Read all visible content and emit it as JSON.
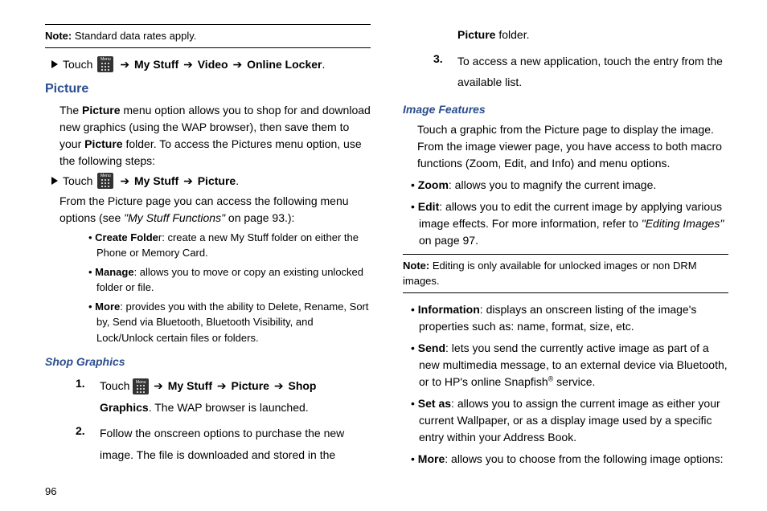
{
  "note1_label": "Note:",
  "note1_text": " Standard data rates apply.",
  "touch_label": "Touch ",
  "arrow": " ➔ ",
  "nav_mystuff": "My Stuff",
  "nav_video": "Video",
  "nav_online_locker": "Online Locker",
  "nav_picture": "Picture",
  "nav_shop_graphics": "Shop Graphics",
  "period": ".",
  "picture_heading": "Picture",
  "picture_p1a": "The ",
  "picture_p1b": "Picture",
  "picture_p1c": " menu option allows you to shop for and download new graphics (using the WAP browser), then save them to your ",
  "picture_p1d": "Picture",
  "picture_p1e": " folder. To access the Pictures menu option, use the following steps:",
  "picture_p2a": "From the Picture page you can access the following menu options (see ",
  "picture_p2b": "\"My Stuff Functions\"",
  "picture_p2c": " on page 93.):",
  "b1_label": "Create Folde",
  "b1_text": "r: create a new My Stuff folder on either the Phone or Memory Card.",
  "b2_label": "Manage",
  "b2_text": ": allows you to move or copy an existing unlocked folder or file.",
  "b3_label": "More",
  "b3_text": ": provides you with the ability to Delete, Rename, Sort by, Send via Bluetooth, Bluetooth Visibility, and Lock/Unlock certain files or folders.",
  "shop_heading": "Shop Graphics",
  "shop_step1_n": "1.",
  "shop_step1_c": ". The WAP browser is launched.",
  "shop_step2_n": "2.",
  "shop_step2a": "Follow the onscreen options to purchase the new image. The file is downloaded and stored in the ",
  "shop_step2b": "Picture",
  "shop_step2c": " folder.",
  "shop_step3_n": "3.",
  "shop_step3": "To access a new application, touch the entry from the available list.",
  "img_heading": "Image Features",
  "img_p1": "Touch a graphic from the Picture page to display the image. From the image viewer page, you have access to both macro functions (Zoom, Edit, and Info) and menu options.",
  "ib1_label": "Zoom",
  "ib1_text": ": allows you to magnify the current image.",
  "ib2_label": "Edit",
  "ib2a": ": allows you to edit the current image by applying various image effects. For more information, refer to ",
  "ib2b": "\"Editing Images\"",
  "ib2c": "  on page 97.",
  "note2_label": "Note:",
  "note2_text": " Editing is only available for unlocked images or non DRM images.",
  "ib3_label": "Information",
  "ib3_text": ": displays an onscreen listing of the image's properties such as: name, format, size, etc.",
  "ib4_label": "Send",
  "ib4a": ": lets you send the currently active image as part of a new multimedia message, to an external device via Bluetooth, or to HP's online Snapfish",
  "ib4b": "®",
  "ib4c": " service.",
  "ib5_label": "Set as",
  "ib5_text": ": allows you to assign the current image as either your current Wallpaper, or as a display image used by a specific entry within your Address Book.",
  "ib6_label": "More",
  "ib6_text": ": allows you to choose from the following image options:",
  "pagenum": "96"
}
